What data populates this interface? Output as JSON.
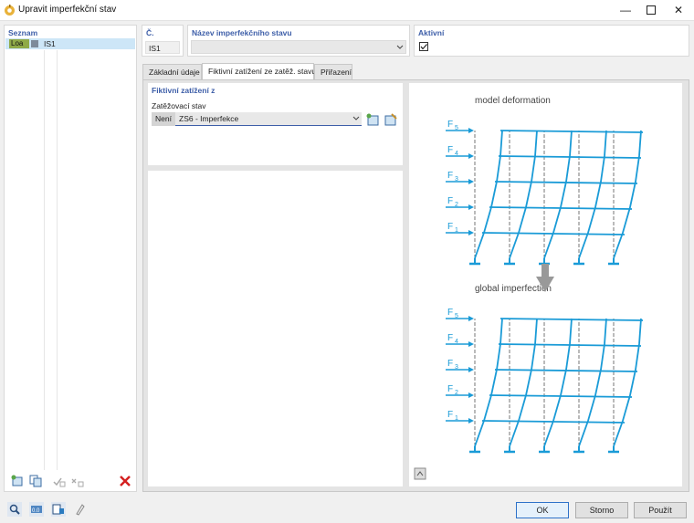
{
  "window": {
    "title": "Upravit imperfekční stav"
  },
  "list": {
    "header": "Seznam",
    "items": [
      {
        "tag": "Loa",
        "name": "IS1"
      }
    ]
  },
  "number": {
    "label": "Č.",
    "value": "IS1"
  },
  "name_field": {
    "label": "Název imperfekčního stavu",
    "value": ""
  },
  "active": {
    "label": "Aktivní",
    "checked": true
  },
  "tabs": [
    {
      "label": "Základní údaje"
    },
    {
      "label": "Fiktivní zatížení ze zatěž. stavu"
    },
    {
      "label": "Přiřazení"
    }
  ],
  "fictitious": {
    "section_title": "Fiktivní zatížení z",
    "load_case_label": "Zatěžovací stav",
    "load_case_tag": "Není",
    "load_case_value": "ZS6 - Imperfekce"
  },
  "diagram": {
    "top_label": "model deformation",
    "bottom_label": "global imperfection",
    "forces": [
      {
        "base": "F",
        "sub": "5"
      },
      {
        "base": "F",
        "sub": "4"
      },
      {
        "base": "F",
        "sub": "3"
      },
      {
        "base": "F",
        "sub": "2"
      },
      {
        "base": "F",
        "sub": "1"
      }
    ],
    "color": "#1a9bd7"
  },
  "footer": {
    "ok": "OK",
    "cancel": "Storno",
    "apply": "Použít"
  },
  "colors": {
    "accent": "#3d5ea8",
    "tag_green": "#8faa48",
    "selection": "#cde6f7"
  }
}
